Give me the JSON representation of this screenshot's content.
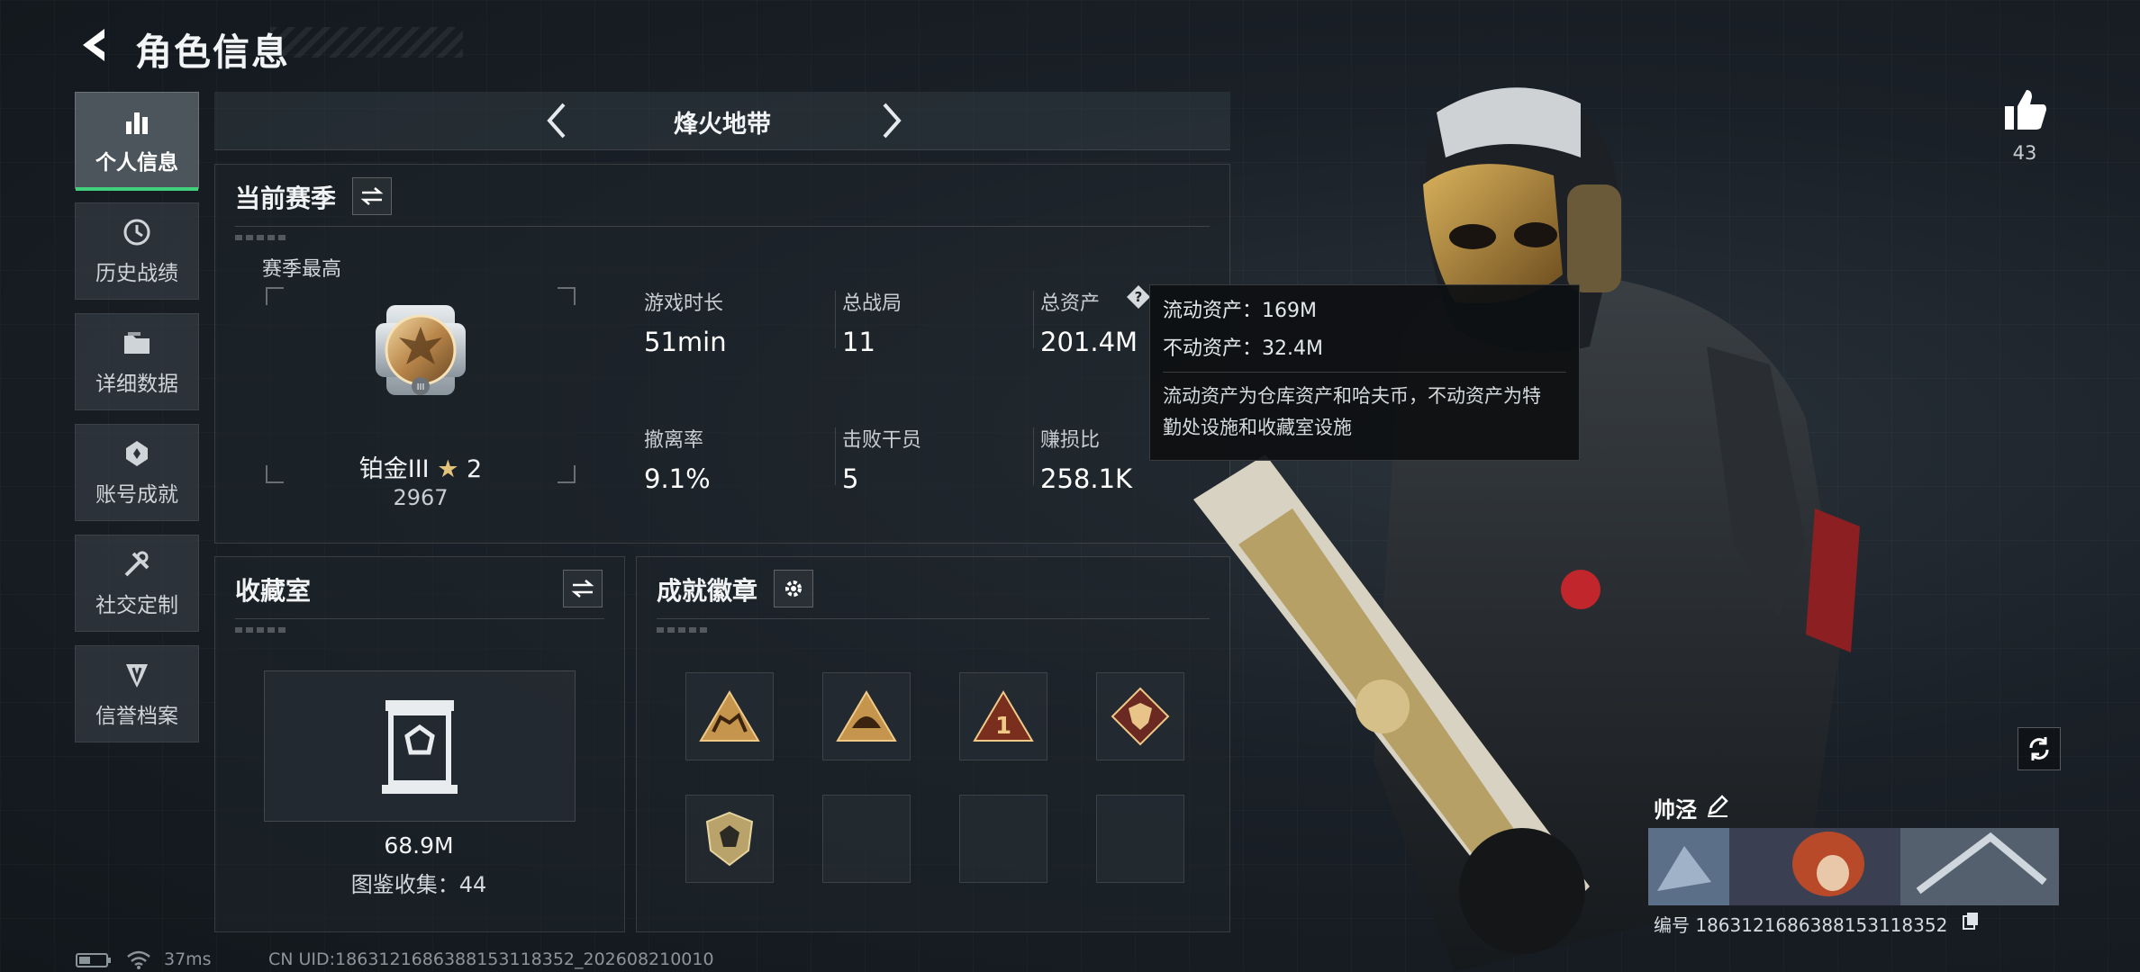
{
  "header": {
    "title": "角色信息"
  },
  "nav": {
    "items": [
      {
        "label": "个人信息",
        "icon": "bar-chart-icon",
        "active": true
      },
      {
        "label": "历史战绩",
        "icon": "history-icon",
        "active": false
      },
      {
        "label": "详细数据",
        "icon": "folder-icon",
        "active": false
      },
      {
        "label": "账号成就",
        "icon": "achievement-icon",
        "active": false
      },
      {
        "label": "社交定制",
        "icon": "tools-icon",
        "active": false
      },
      {
        "label": "信誉档案",
        "icon": "credit-icon",
        "active": false
      }
    ]
  },
  "mode": {
    "title": "烽火地带"
  },
  "season": {
    "title": "当前赛季",
    "best_label": "赛季最高",
    "rank_name": "铂金III",
    "rank_stars": "2",
    "rank_score": "2967",
    "stats": [
      {
        "label": "游戏时长",
        "value": "51min"
      },
      {
        "label": "总战局",
        "value": "11"
      },
      {
        "label": "总资产",
        "value": "201.4M"
      },
      {
        "label": "撤离率",
        "value": "9.1%"
      },
      {
        "label": "击败干员",
        "value": "5"
      },
      {
        "label": "赚损比",
        "value": "258.1K"
      }
    ]
  },
  "tooltip": {
    "liquid": "流动资产：169M",
    "fixed": "不动资产：32.4M",
    "desc": "流动资产为仓库资产和哈夫币，不动资产为特勤处设施和收藏室设施"
  },
  "collection": {
    "title": "收藏室",
    "value": "68.9M",
    "count_text": "图鉴收集：44"
  },
  "badges": {
    "title": "成就徽章",
    "items": [
      {
        "icon": "camel-badge-icon",
        "empty": false
      },
      {
        "icon": "helmet-badge-icon",
        "empty": false
      },
      {
        "icon": "number-one-badge-icon",
        "empty": false
      },
      {
        "icon": "wolf-badge-icon",
        "empty": false
      },
      {
        "icon": "shield-badge-icon",
        "empty": false
      },
      {
        "icon": "",
        "empty": true
      },
      {
        "icon": "",
        "empty": true
      },
      {
        "icon": "",
        "empty": true
      }
    ]
  },
  "profile": {
    "likes": "43",
    "name": "帅泾",
    "id_text": "编号 1863121686388153118352"
  },
  "footer": {
    "ping": "37ms",
    "uid": "CN UID:1863121686388153118352_202608210010"
  }
}
